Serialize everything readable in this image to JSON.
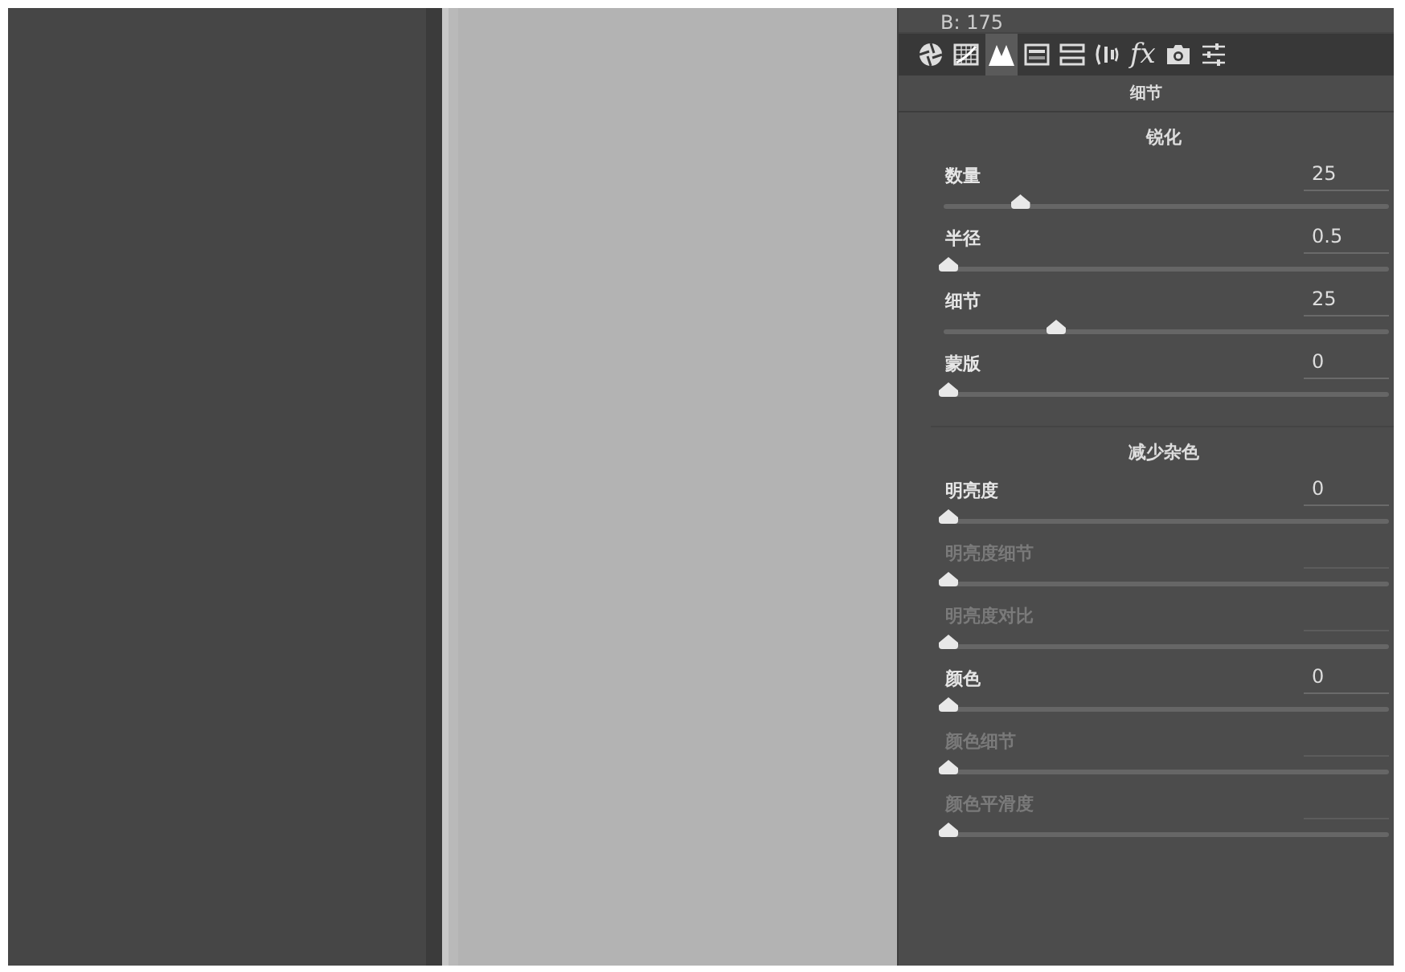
{
  "readout": "B: 175",
  "tabs": [
    {
      "kind": "aperture",
      "selected": false
    },
    {
      "kind": "curve",
      "selected": false
    },
    {
      "kind": "peaks",
      "selected": true
    },
    {
      "kind": "split",
      "selected": false
    },
    {
      "kind": "bars",
      "selected": false
    },
    {
      "kind": "lens",
      "selected": false
    },
    {
      "kind": "fx",
      "label": "fx",
      "selected": false
    },
    {
      "kind": "camera",
      "selected": false
    },
    {
      "kind": "sliders",
      "selected": false
    }
  ],
  "panel_title": "细节",
  "sections": [
    {
      "title": "锐化",
      "sliders": [
        {
          "label": "数量",
          "value": "25",
          "level": 0.167,
          "disabled": false
        },
        {
          "label": "半径",
          "value": "0.5",
          "level": 0,
          "disabled": false
        },
        {
          "label": "细节",
          "value": "25",
          "level": 0.25,
          "disabled": false
        },
        {
          "label": "蒙版",
          "value": "0",
          "level": 0,
          "disabled": false
        }
      ]
    },
    {
      "title": "减少杂色",
      "sliders": [
        {
          "label": "明亮度",
          "value": "0",
          "level": 0,
          "disabled": false
        },
        {
          "label": "明亮度细节",
          "level": 0,
          "disabled": true
        },
        {
          "label": "明亮度对比",
          "level": 0,
          "disabled": true
        },
        {
          "label": "颜色",
          "value": "0",
          "level": 0,
          "disabled": false
        },
        {
          "label": "颜色细节",
          "level": 0,
          "disabled": true
        },
        {
          "label": "颜色平滑度",
          "level": 0,
          "disabled": true
        }
      ]
    }
  ]
}
